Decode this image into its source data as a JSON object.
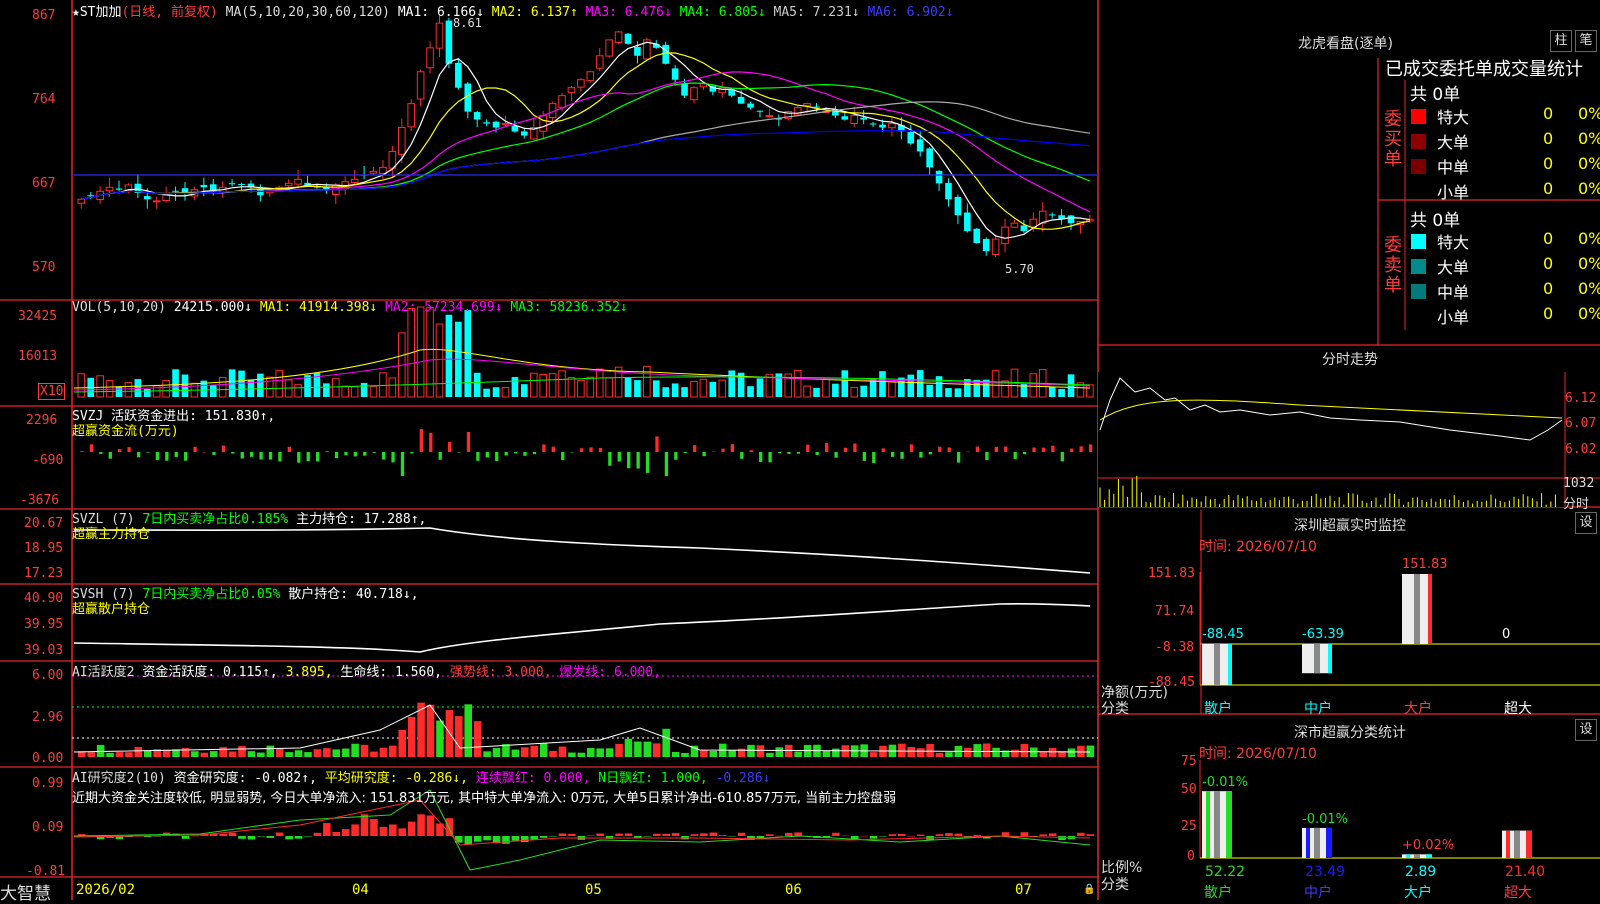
{
  "app": {
    "logo": "大智慧",
    "lock_icon": "lock-icon"
  },
  "kline": {
    "stock": "★ST加加",
    "mode": "(日线, 前复权)",
    "ma_def": "MA(5,10,20,30,60,120)",
    "ma1": "MA1: 6.166↓",
    "ma2": "MA2: 6.137↑",
    "ma3": "MA3: 6.476↓",
    "ma4": "MA4: 6.805↓",
    "ma5": "MA5: 7.231↓",
    "ma6": "MA6: 6.902↓",
    "y_ticks": [
      "867",
      "764",
      "667",
      "570"
    ],
    "high_label": "8.61",
    "low_label": "5.70",
    "colors": {
      "ma1": "#ffffff",
      "ma2": "#ffff00",
      "ma3": "#ff00ff",
      "ma4": "#00ff00",
      "ma5": "#aaaaaa",
      "ma6": "#0000ff"
    }
  },
  "vol": {
    "def": "VOL(5,10,20)",
    "value": "24215.000↓",
    "ma1": "MA1: 41914.398↓",
    "ma2": "MA2: 57234.699↓",
    "ma3": "MA3: 58236.352↓",
    "y_ticks": [
      "32425",
      "16013"
    ],
    "unit": "X10"
  },
  "svzj": {
    "title": "SVZJ  活跃资金进出: 151.830↑,",
    "sub": "超赢资金流(万元)",
    "y_ticks": [
      "2296",
      "-690",
      "-3676"
    ]
  },
  "svzl": {
    "title_a": "SVZL (7)",
    "title_b": "7日内买卖净占比0.185%",
    "title_c": "主力持仓: 17.288↑,",
    "sub": "超赢主力持仓",
    "y_ticks": [
      "20.67",
      "18.95",
      "17.23"
    ]
  },
  "svsh": {
    "title_a": "SVSH (7)",
    "title_b": "7日内买卖净占比0.05%",
    "title_c": "散户持仓: 40.718↓,",
    "sub": "超赢散户持仓",
    "y_ticks": [
      "40.90",
      "39.95",
      "39.03"
    ]
  },
  "ai1": {
    "a": "AI活跃度2",
    "b": "资金活跃度: 0.115↑,",
    "c": "3.895,",
    "d": "生命线: 1.560,",
    "e": "强势线: 3.000,",
    "f": "爆发线: 6.000,",
    "y_ticks": [
      "6.00",
      "2.96",
      "0.00"
    ]
  },
  "ai2": {
    "a": "AI研究度2(10)",
    "b": "资金研究度: -0.082↑,",
    "c": "平均研究度: -0.286↓,",
    "d": "连续飘红: 0.000,",
    "e": "N日飘红: 1.000,",
    "f": "-0.286↓",
    "comment": "近期大资金关注度较低, 明显弱势, 今日大单净流入: 151.831万元, 其中特大单净流入: 0万元, 大单5日累计净出-610.857万元, 当前主力控盘弱",
    "y_ticks": [
      "0.99",
      "0.09",
      "-0.81"
    ]
  },
  "x_axis": {
    "labels": [
      "2026/02",
      "04",
      "05",
      "06",
      "07"
    ]
  },
  "dragon": {
    "title": "龙虎看盘(逐单)",
    "btn_a": "柱",
    "btn_b": "笔",
    "header": "已成交委托单成交量统计",
    "buy_label": "委买单",
    "sell_label": "委卖单",
    "buy_total": "共 0单",
    "sell_total": "共 0单",
    "buy_rows": [
      {
        "name": "特大",
        "count": "0",
        "pct": "0%"
      },
      {
        "name": "大单",
        "count": "0",
        "pct": "0%"
      },
      {
        "name": "中单",
        "count": "0",
        "pct": "0%"
      },
      {
        "name": "小单",
        "count": "0",
        "pct": "0%"
      }
    ],
    "sell_rows": [
      {
        "name": "特大",
        "count": "0",
        "pct": "0%"
      },
      {
        "name": "大单",
        "count": "0",
        "pct": "0%"
      },
      {
        "name": "中单",
        "count": "0",
        "pct": "0%"
      },
      {
        "name": "小单",
        "count": "0",
        "pct": "0%"
      }
    ],
    "buy_colors": [
      "#ff0000",
      "#8b0000",
      "#7a0000",
      ""
    ],
    "sell_colors": [
      "#00ffff",
      "#008b8b",
      "#007a7a",
      ""
    ]
  },
  "intraday": {
    "title": "分时走势",
    "y_ticks": [
      "6.12",
      "6.07",
      "6.02"
    ],
    "vol_label": "1032",
    "vol_unit": "分时"
  },
  "sz_monitor": {
    "title": "深圳超赢实时监控",
    "set": "设",
    "time": "时间: 2026/07/10",
    "y_ticks": [
      "151.83",
      "71.74",
      "-8.38",
      "-88.45"
    ],
    "axis_name": "净额(万元)",
    "axis_cat": "分类",
    "categories": [
      "散户",
      "中户",
      "大户",
      "超大"
    ],
    "values": [
      -88.45,
      -63.39,
      151.83,
      0
    ],
    "value_labels": [
      "-88.45",
      "-63.39",
      "151.83",
      "0"
    ]
  },
  "sz_class": {
    "title": "深市超赢分类统计",
    "set": "设",
    "time": "时间: 2026/07/10",
    "y_ticks": [
      "75",
      "50",
      "25",
      "0"
    ],
    "axis_name": "比例%",
    "axis_cat": "分类",
    "categories": [
      "散户",
      "中户",
      "大户",
      "超大"
    ],
    "values": [
      52.22,
      23.49,
      2.89,
      21.4
    ],
    "value_labels": [
      "52.22",
      "23.49",
      "2.89",
      "21.40"
    ],
    "change_labels": [
      "-0.01%",
      "-0.01%",
      "+0.02%",
      ""
    ]
  },
  "chart_data": {
    "type": "candlestick",
    "title": "★ST加加 (日线, 前复权)",
    "x": [
      "2026/02",
      "04",
      "05",
      "06",
      "07"
    ],
    "ylim": [
      5.5,
      8.8
    ],
    "series": [
      {
        "name": "MA1",
        "last": 6.166
      },
      {
        "name": "MA2",
        "last": 6.137
      },
      {
        "name": "MA3",
        "last": 6.476
      },
      {
        "name": "MA4",
        "last": 6.805
      },
      {
        "name": "MA5",
        "last": 7.231
      },
      {
        "name": "MA6",
        "last": 6.902
      }
    ],
    "annotations": [
      {
        "text": "8.61",
        "value": 8.61
      },
      {
        "text": "5.70",
        "value": 5.7
      }
    ],
    "close_series": [
      6.4,
      6.45,
      6.5,
      6.55,
      6.52,
      6.58,
      6.48,
      6.4,
      6.38,
      6.45,
      6.5,
      6.48,
      6.52,
      6.55,
      6.5,
      6.55,
      6.6,
      6.58,
      6.55,
      6.45,
      6.5,
      6.55,
      6.6,
      6.65,
      6.58,
      6.55,
      6.52,
      6.58,
      6.62,
      6.65,
      6.7,
      6.75,
      6.8,
      7.0,
      7.3,
      7.6,
      8.0,
      8.3,
      8.61,
      8.1,
      7.8,
      7.5,
      7.4,
      7.35,
      7.3,
      7.35,
      7.25,
      7.2,
      7.3,
      7.45,
      7.6,
      7.7,
      7.8,
      7.9,
      8.0,
      8.2,
      8.4,
      8.5,
      8.35,
      8.2,
      8.4,
      8.3,
      8.1,
      7.9,
      7.7,
      7.8,
      7.85,
      7.75,
      7.8,
      7.7,
      7.6,
      7.55,
      7.5,
      7.45,
      7.4,
      7.5,
      7.55,
      7.6,
      7.55,
      7.5,
      7.45,
      7.4,
      7.45,
      7.4,
      7.35,
      7.3,
      7.35,
      7.25,
      7.1,
      7.0,
      6.8,
      6.6,
      6.4,
      6.2,
      6.0,
      5.85,
      5.75,
      5.9,
      6.05,
      6.1,
      6.0,
      6.15,
      6.25,
      6.2,
      6.15,
      6.1,
      6.12,
      6.15
    ]
  }
}
